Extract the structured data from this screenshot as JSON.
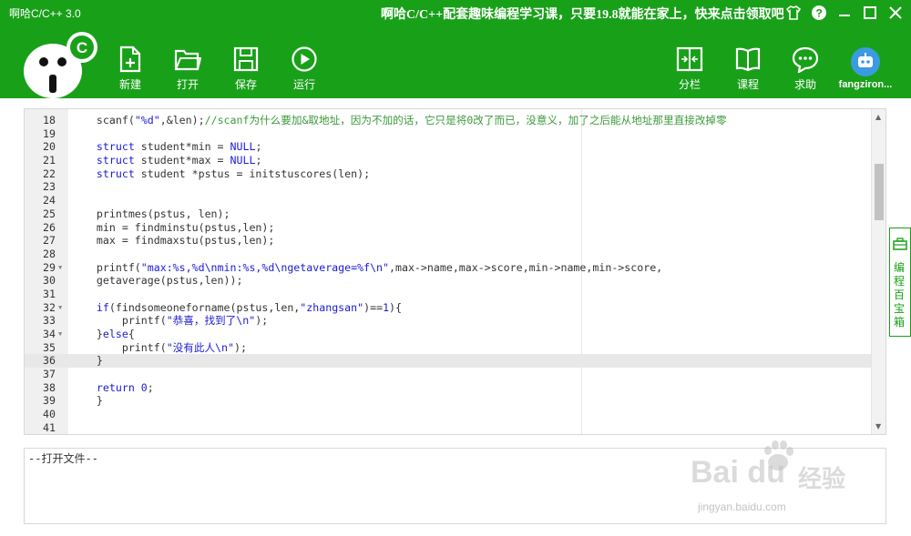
{
  "window": {
    "title": "啊哈C/C++ 3.0",
    "promo": "啊哈C/C++配套趣味编程学习课，只要19.8就能在家上，快来点击领取吧"
  },
  "toolbar": {
    "new_label": "新建",
    "open_label": "打开",
    "save_label": "保存",
    "run_label": "运行",
    "split_label": "分栏",
    "course_label": "课程",
    "help_label": "求助",
    "username": "fangziron..."
  },
  "editor": {
    "active_line": "36",
    "lines": [
      {
        "n": "18",
        "fold": "",
        "code": "scanf(\"%d\",&len);//scanf为什么要加&取地址，因为不加的话，它只是将0改了而已，没意义，加了之后能从地址那里直接改掉零"
      },
      {
        "n": "19",
        "fold": "",
        "code": ""
      },
      {
        "n": "20",
        "fold": "",
        "code": "struct student*min = NULL;"
      },
      {
        "n": "21",
        "fold": "",
        "code": "struct student*max = NULL;"
      },
      {
        "n": "22",
        "fold": "",
        "code": "struct student *pstus = initstuscores(len);"
      },
      {
        "n": "23",
        "fold": "",
        "code": ""
      },
      {
        "n": "24",
        "fold": "",
        "code": ""
      },
      {
        "n": "25",
        "fold": "",
        "code": "printmes(pstus, len);"
      },
      {
        "n": "26",
        "fold": "",
        "code": "min = findminstu(pstus,len);"
      },
      {
        "n": "27",
        "fold": "",
        "code": "max = findmaxstu(pstus,len);"
      },
      {
        "n": "28",
        "fold": "",
        "code": ""
      },
      {
        "n": "29",
        "fold": "▼",
        "code": "printf(\"max:%s,%d\\nmin:%s,%d\\ngetaverage=%f\\n\",max->name,max->score,min->name,min->score,"
      },
      {
        "n": "30",
        "fold": "",
        "code": "getaverage(pstus,len));"
      },
      {
        "n": "31",
        "fold": "",
        "code": ""
      },
      {
        "n": "32",
        "fold": "▼",
        "code": "if(findsomeoneforname(pstus,len,\"zhangsan\")==1){"
      },
      {
        "n": "33",
        "fold": "",
        "code": "    printf(\"恭喜，找到了\\n\");"
      },
      {
        "n": "34",
        "fold": "▼",
        "code": "}else{"
      },
      {
        "n": "35",
        "fold": "",
        "code": "    printf(\"没有此人\\n\");"
      },
      {
        "n": "36",
        "fold": "",
        "code": "}"
      },
      {
        "n": "37",
        "fold": "",
        "code": ""
      },
      {
        "n": "38",
        "fold": "",
        "code": "return 0;"
      },
      {
        "n": "39",
        "fold": "",
        "code": "}"
      },
      {
        "n": "40",
        "fold": "",
        "code": ""
      },
      {
        "n": "41",
        "fold": "",
        "code": ""
      }
    ]
  },
  "side_panel": {
    "label": "编程百宝箱"
  },
  "output": {
    "text": "--打开文件--"
  },
  "watermark": {
    "brand": "Bai du",
    "brand_cn": "经验",
    "url": "jingyan.baidu.com"
  },
  "colors": {
    "brand_green": "#19a019",
    "keyword_blue": "#1a1ad8",
    "comment_green": "#3a9a3a",
    "avatar_blue": "#3b9be0"
  },
  "icons": [
    "shirt-icon",
    "help-icon",
    "minimize-icon",
    "maximize-icon",
    "close-icon",
    "new-file-icon",
    "open-folder-icon",
    "save-icon",
    "run-icon",
    "split-icon",
    "course-book-icon",
    "help-chat-icon",
    "toolbox-icon"
  ]
}
